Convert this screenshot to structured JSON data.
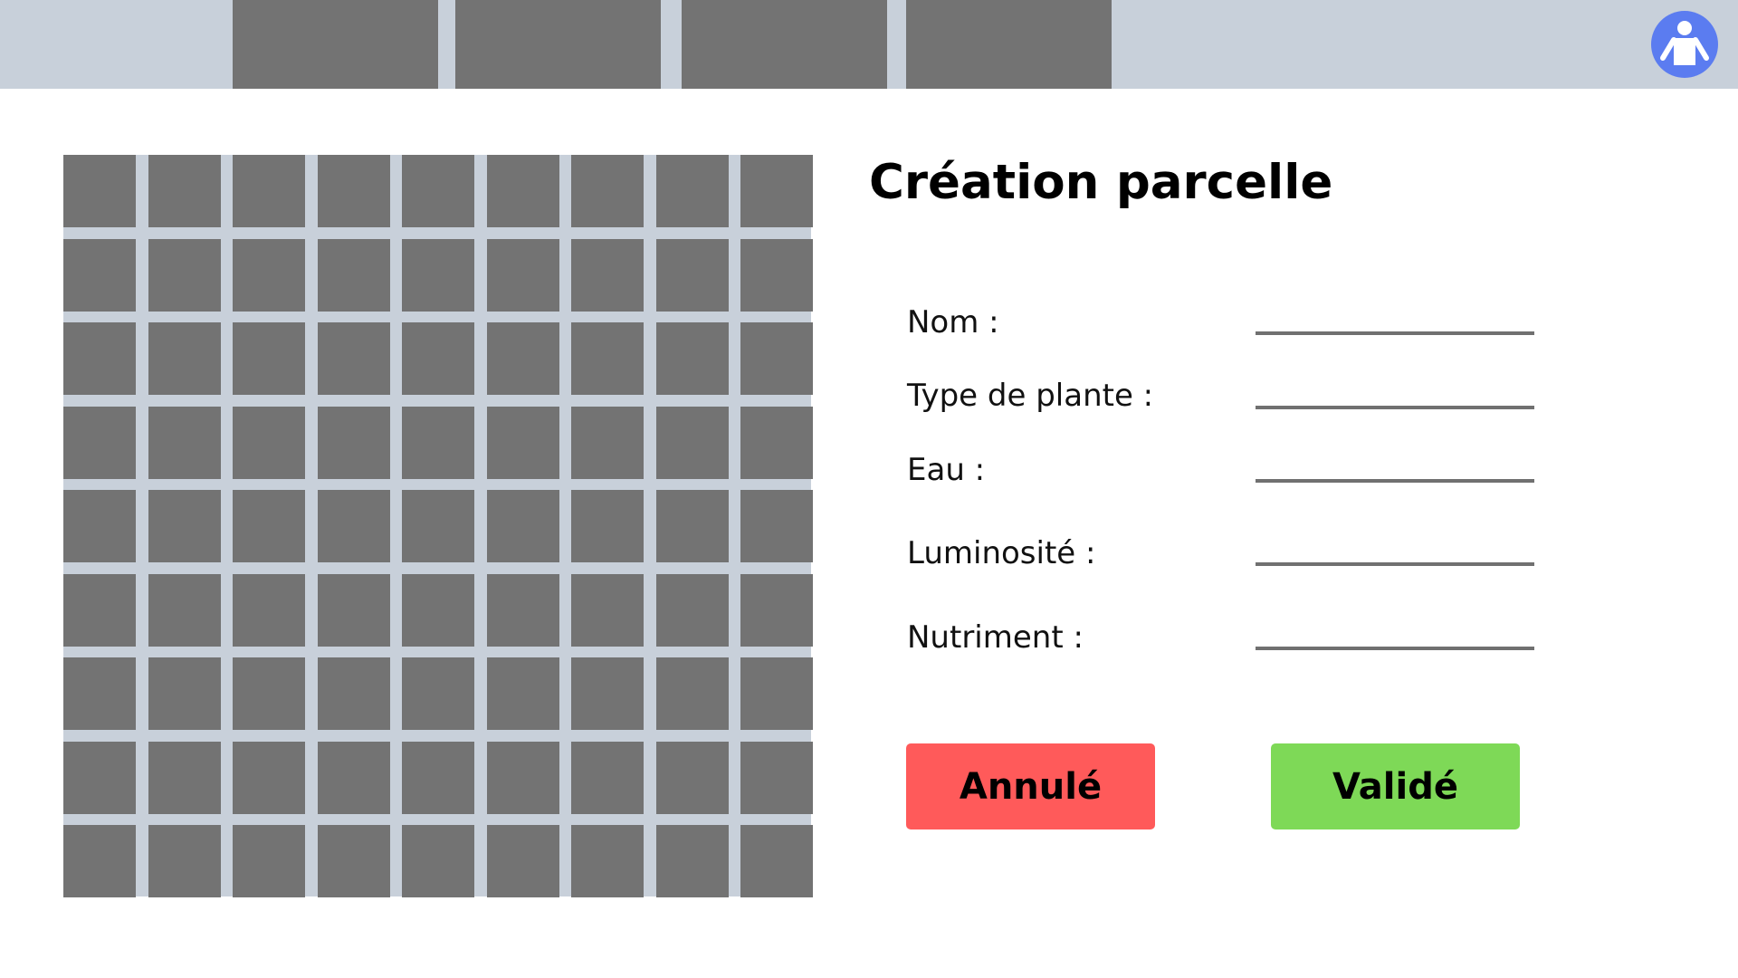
{
  "nav": {
    "tabs": [
      {
        "label": ""
      },
      {
        "label": ""
      },
      {
        "label": ""
      },
      {
        "label": ""
      }
    ],
    "user_icon": "user-icon"
  },
  "plot_grid": {
    "rows": 9,
    "columns": 9
  },
  "form": {
    "title": "Création parcelle",
    "fields": [
      {
        "label": "Nom :",
        "value": ""
      },
      {
        "label": "Type de plante :",
        "value": ""
      },
      {
        "label": "Eau :",
        "value": ""
      },
      {
        "label": "Luminosité :",
        "value": ""
      },
      {
        "label": "Nutriment :",
        "value": ""
      }
    ],
    "cancel_label": "Annulé",
    "submit_label": "Validé"
  },
  "colors": {
    "topbar": "#c8d0da",
    "tab": "#737373",
    "cell": "#737373",
    "avatar": "#5b7cf0",
    "cancel": "#ff5a5a",
    "submit": "#7ed957"
  }
}
